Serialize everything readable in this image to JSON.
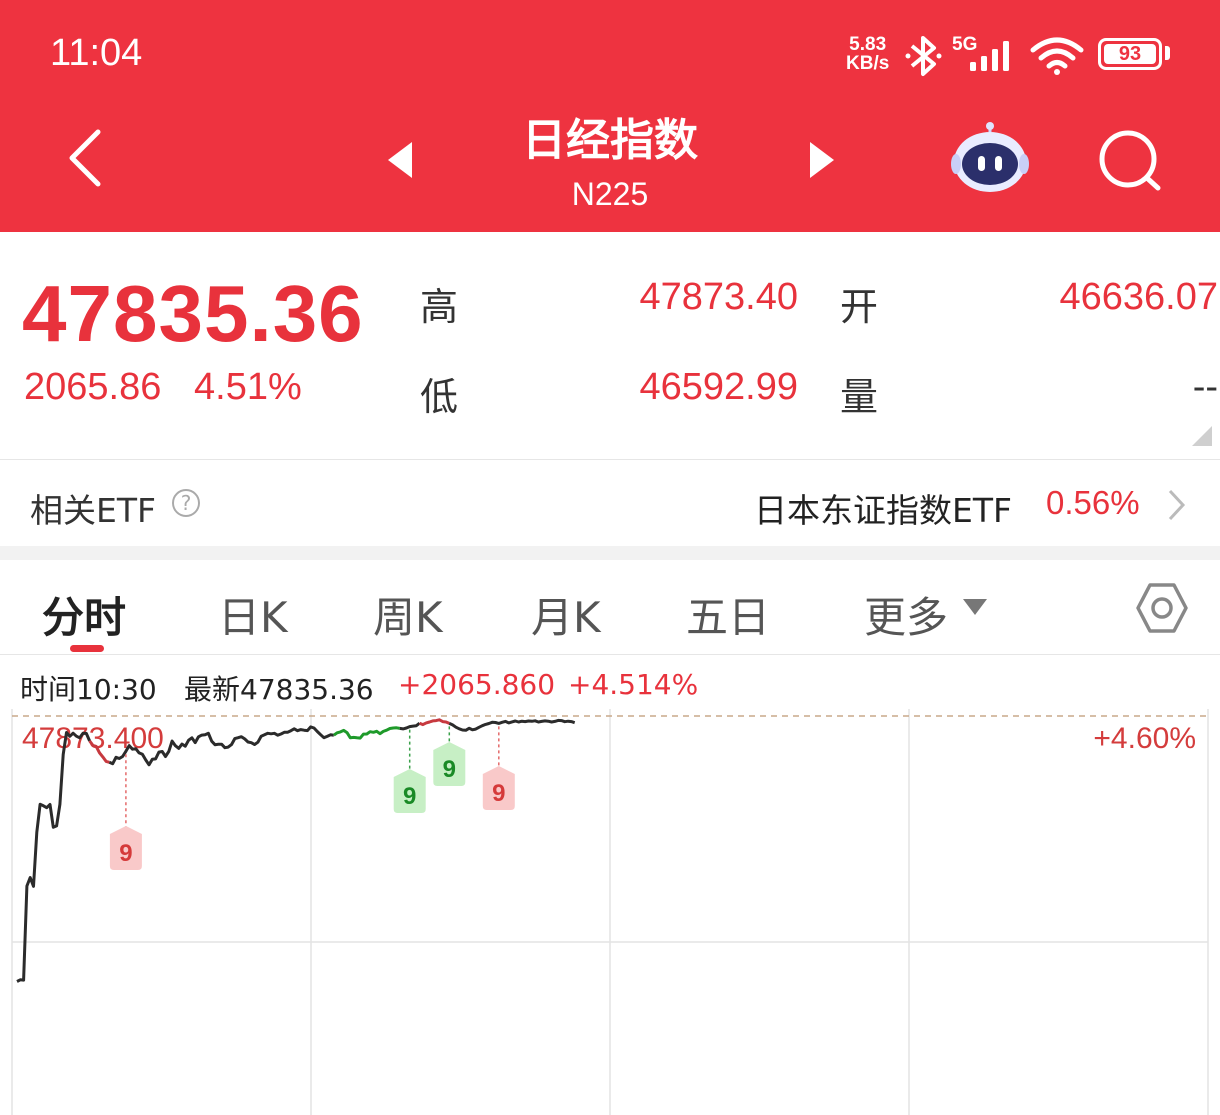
{
  "status_bar": {
    "time": "11:04",
    "net_speed_value": "5.83",
    "net_speed_unit": "KB/s",
    "network": "5G",
    "battery": "93"
  },
  "header": {
    "title": "日经指数",
    "subtitle": "N225"
  },
  "quote": {
    "price": "47835.36",
    "change": "2065.86",
    "change_pct": "4.51%",
    "high_label": "高",
    "high_value": "47873.40",
    "open_label": "开",
    "open_value": "46636.07",
    "low_label": "低",
    "low_value": "46592.99",
    "volume_label": "量",
    "volume_value": "--"
  },
  "etf": {
    "label": "相关ETF",
    "help": "?",
    "name": "日本东证指数ETF",
    "pct": "0.56%"
  },
  "tabs": [
    {
      "label": "分时"
    },
    {
      "label": "日K"
    },
    {
      "label": "周K"
    },
    {
      "label": "月K"
    },
    {
      "label": "五日"
    },
    {
      "label": "更多"
    }
  ],
  "info": {
    "time": "时间10:30",
    "latest": "最新47835.36",
    "change": "+2065.860",
    "change_pct": "+4.514%"
  },
  "chart_data": {
    "type": "line",
    "top_price_label": "47873.400",
    "top_pct_label": "+4.60%",
    "ylim": [
      45925.0,
      47900.0
    ],
    "markers": [
      {
        "label": "9",
        "color": "red",
        "x": 33
      },
      {
        "label": "9",
        "color": "green",
        "x": 119
      },
      {
        "label": "9",
        "color": "green",
        "x": 131
      },
      {
        "label": "9",
        "color": "red",
        "x": 146
      }
    ],
    "series": [
      {
        "values": [
          45951,
          45963,
          45961,
          46652,
          46714,
          46650,
          47046,
          47252,
          47241,
          47227,
          47250,
          47083,
          47093,
          47251,
          47617,
          47779,
          47751,
          47774,
          47752,
          47740,
          47773,
          47772,
          47717,
          47684,
          47677,
          47630,
          47600,
          47567,
          47560,
          47550,
          47597,
          47588,
          47603,
          47641,
          47683,
          47656,
          47660,
          47629,
          47619,
          47578,
          47542,
          47582,
          47585,
          47635,
          47639,
          47603,
          47640,
          47716,
          47682,
          47662,
          47694,
          47678,
          47722,
          47740,
          47705,
          47747,
          47760,
          47762,
          47773,
          47715,
          47689,
          47692,
          47693,
          47667,
          47672,
          47690,
          47734,
          47741,
          47748,
          47732,
          47709,
          47704,
          47691,
          47708,
          47752,
          47762,
          47773,
          47769,
          47773,
          47759,
          47768,
          47780,
          47781,
          47792,
          47806,
          47792,
          47800,
          47796,
          47793,
          47820,
          47812,
          47786,
          47763,
          47741,
          47750,
          47762,
          47759,
          47777,
          47783,
          47794,
          47778,
          47740,
          47743,
          47740,
          47738,
          47767,
          47768,
          47785,
          47780,
          47788,
          47770,
          47787,
          47796,
          47808,
          47812,
          47813,
          47809,
          47805,
          47812,
          47822,
          47826,
          47829,
          47847,
          47837,
          47849,
          47856,
          47864,
          47866,
          47872,
          47859,
          47856,
          47846,
          47835,
          47818,
          47806,
          47797,
          47795,
          47810,
          47799,
          47804,
          47817,
          47829,
          47838,
          47845,
          47854,
          47852,
          47846,
          47854,
          47860,
          47849,
          47857,
          47863,
          47856,
          47862,
          47859,
          47863,
          47861,
          47865,
          47856,
          47860,
          47864,
          47862,
          47856,
          47860,
          47868,
          47866,
          47858,
          47862,
          47859,
          47851
        ]
      }
    ]
  }
}
